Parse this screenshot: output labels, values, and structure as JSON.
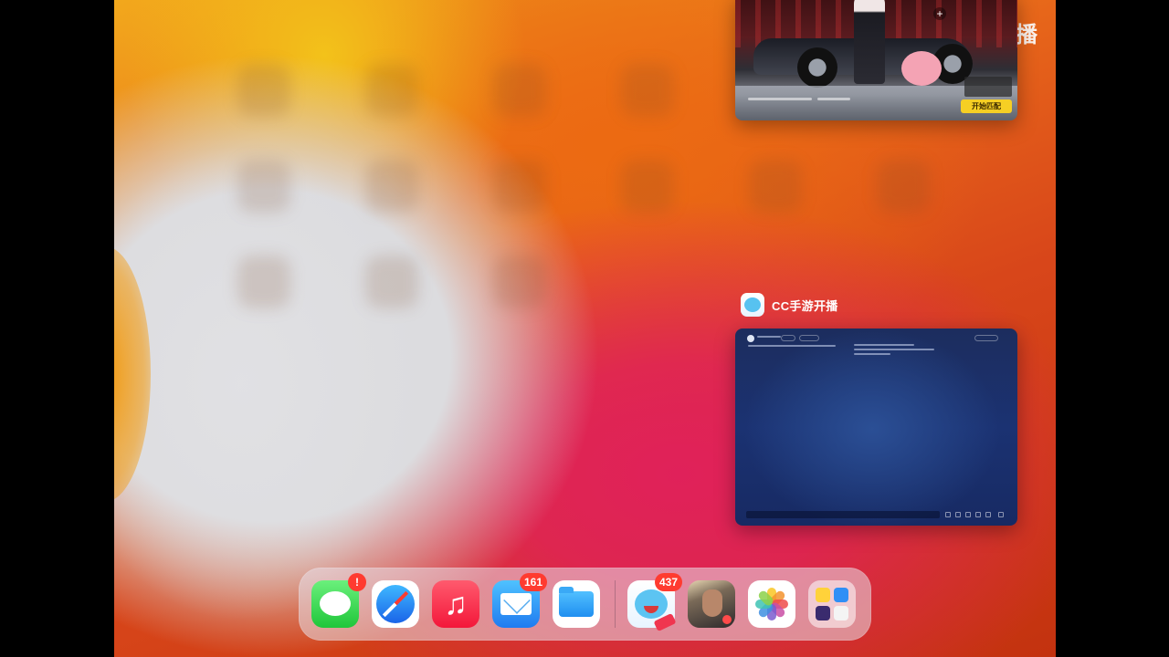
{
  "watermark": {
    "text": "CC直播"
  },
  "switcher": {
    "game_card": {
      "start_button": "开始匹配"
    },
    "cc_app": {
      "name": "CC手游开播",
      "icon": "cc-app-icon"
    }
  },
  "dock": {
    "apps": [
      {
        "id": "messages",
        "icon": "messages-icon",
        "badge": "!"
      },
      {
        "id": "safari",
        "icon": "safari-icon",
        "badge": ""
      },
      {
        "id": "music",
        "icon": "music-icon",
        "glyph": "♫",
        "badge": ""
      },
      {
        "id": "mail",
        "icon": "mail-icon",
        "badge": "161"
      },
      {
        "id": "files",
        "icon": "files-icon",
        "badge": ""
      },
      {
        "id": "cc",
        "icon": "cc-live-icon",
        "badge": "437"
      },
      {
        "id": "game",
        "icon": "game-icon",
        "badge": ""
      },
      {
        "id": "photos",
        "icon": "photos-icon",
        "badge": ""
      },
      {
        "id": "folder",
        "icon": "app-folder-icon",
        "badge": ""
      }
    ]
  },
  "colors": {
    "badge": "#ff3b30",
    "start_button": "#f6cf24",
    "cc_card_bg": "#1b3272"
  }
}
